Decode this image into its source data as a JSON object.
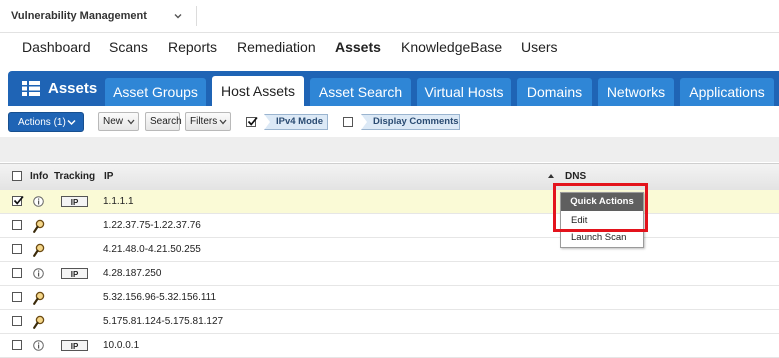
{
  "app": {
    "title": "Vulnerability Management"
  },
  "nav": {
    "items": [
      {
        "label": "Dashboard",
        "active": false
      },
      {
        "label": "Scans",
        "active": false
      },
      {
        "label": "Reports",
        "active": false
      },
      {
        "label": "Remediation",
        "active": false
      },
      {
        "label": "Assets",
        "active": true
      },
      {
        "label": "KnowledgeBase",
        "active": false
      },
      {
        "label": "Users",
        "active": false
      }
    ]
  },
  "tabs": {
    "home_label": "Assets",
    "items": [
      {
        "label": "Asset Groups",
        "active": false
      },
      {
        "label": "Host Assets",
        "active": true
      },
      {
        "label": "Asset Search",
        "active": false
      },
      {
        "label": "Virtual Hosts",
        "active": false
      },
      {
        "label": "Domains",
        "active": false
      },
      {
        "label": "Networks",
        "active": false
      },
      {
        "label": "Applications",
        "active": false
      }
    ]
  },
  "toolbar": {
    "actions_label": "Actions (1)",
    "new_label": "New",
    "search_label": "Search",
    "filters_label": "Filters",
    "ipv4_label": "IPv4 Mode",
    "ipv4_checked": true,
    "comments_label": "Display Comments",
    "comments_checked": false
  },
  "grid": {
    "columns": {
      "info": "Info",
      "tracking": "Tracking",
      "ip": "IP",
      "dns": "DNS"
    },
    "rows": [
      {
        "ip": "1.1.1.1",
        "icon": "info-icon",
        "tracking": "IP",
        "checked": true
      },
      {
        "ip": "1.22.37.75-1.22.37.76",
        "icon": "magnifier-icon",
        "tracking": "",
        "checked": false
      },
      {
        "ip": "4.21.48.0-4.21.50.255",
        "icon": "magnifier-icon",
        "tracking": "",
        "checked": false
      },
      {
        "ip": "4.28.187.250",
        "icon": "info-icon",
        "tracking": "IP",
        "checked": false
      },
      {
        "ip": "5.32.156.96-5.32.156.111",
        "icon": "magnifier-icon",
        "tracking": "",
        "checked": false
      },
      {
        "ip": "5.175.81.124-5.175.81.127",
        "icon": "magnifier-icon",
        "tracking": "",
        "checked": false
      },
      {
        "ip": "10.0.0.1",
        "icon": "info-icon",
        "tracking": "IP",
        "checked": false
      }
    ]
  },
  "quick_actions": {
    "title": "Quick Actions",
    "items": [
      "Edit",
      "Launch Scan"
    ]
  },
  "colors": {
    "tab_bar": "#1f64b5",
    "tab": "#2f86d6",
    "selected_row": "#fafad6",
    "highlight": "#e3131c"
  }
}
